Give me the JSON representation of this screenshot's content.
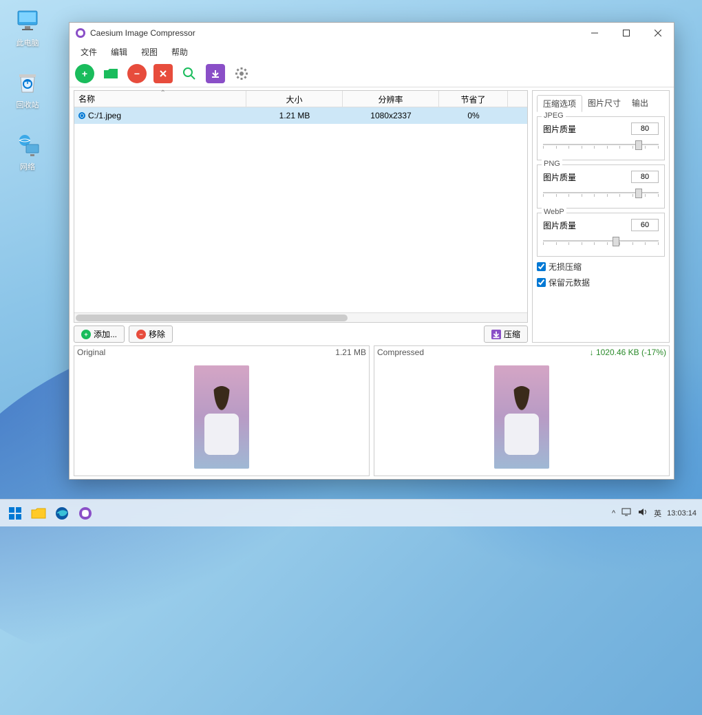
{
  "desktop": {
    "icons": [
      {
        "label": "此电脑"
      },
      {
        "label": "回收站"
      },
      {
        "label": "网络"
      }
    ]
  },
  "window": {
    "title": "Caesium Image Compressor",
    "menu": [
      "文件",
      "编辑",
      "视图",
      "帮助"
    ],
    "table": {
      "headers": [
        "名称",
        "大小",
        "分辨率",
        "节省了"
      ],
      "row": {
        "name": "C:/1.jpeg",
        "size": "1.21 MB",
        "resolution": "1080x2337",
        "saved": "0%"
      }
    },
    "actions": {
      "add": "添加...",
      "remove": "移除",
      "compress": "压缩"
    },
    "side": {
      "tabs": [
        "压缩选项",
        "图片尺寸",
        "输出"
      ],
      "jpeg": {
        "title": "JPEG",
        "label": "图片质量",
        "value": "80",
        "pos": 80
      },
      "png": {
        "title": "PNG",
        "label": "图片质量",
        "value": "80",
        "pos": 80
      },
      "webp": {
        "title": "WebP",
        "label": "图片质量",
        "value": "60",
        "pos": 60
      },
      "lossless": "无损压缩",
      "metadata": "保留元数据"
    },
    "preview": {
      "original_label": "Original",
      "original_size": "1.21 MB",
      "compressed_label": "Compressed",
      "compressed_size": "1020.46 KB (-17%)"
    }
  },
  "taskbar": {
    "ime": "英",
    "time": "13:03:14",
    "chevron": "^"
  }
}
